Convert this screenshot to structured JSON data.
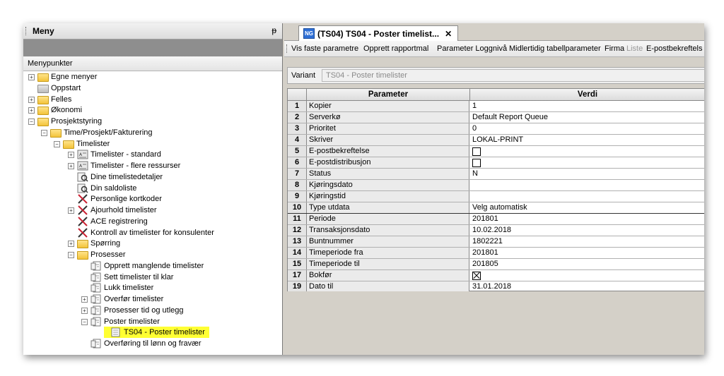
{
  "menu": {
    "title": "Meny",
    "pin": "ᵽ",
    "section_label": "Menypunkter",
    "tree": [
      {
        "label": "Egne menyer",
        "level": 0,
        "expander": "+",
        "icon": "folder-icon"
      },
      {
        "label": "Oppstart",
        "level": 0,
        "expander": "",
        "icon": "folder-gray-icon"
      },
      {
        "label": "Felles",
        "level": 0,
        "expander": "+",
        "icon": "folder-icon"
      },
      {
        "label": "Økonomi",
        "level": 0,
        "expander": "+",
        "icon": "folder-icon"
      },
      {
        "label": "Prosjektstyring",
        "level": 0,
        "expander": "−",
        "icon": "folder-open-icon"
      },
      {
        "label": "Time/Prosjekt/Fakturering",
        "level": 1,
        "expander": "−",
        "icon": "folder-open-icon"
      },
      {
        "label": "Timelister",
        "level": 2,
        "expander": "−",
        "icon": "folder-open-icon"
      },
      {
        "label": "Timelister - standard",
        "level": 3,
        "expander": "+",
        "icon": "report-icon"
      },
      {
        "label": "Timelister - flere ressurser",
        "level": 3,
        "expander": "+",
        "icon": "report-icon"
      },
      {
        "label": "Dine timelistedetaljer",
        "level": 3,
        "expander": "",
        "icon": "search-doc-icon"
      },
      {
        "label": "Din saldoliste",
        "level": 3,
        "expander": "",
        "icon": "search-doc-icon"
      },
      {
        "label": "Personlige kortkoder",
        "level": 3,
        "expander": "",
        "icon": "tools-icon"
      },
      {
        "label": "Ajourhold timelister",
        "level": 3,
        "expander": "+",
        "icon": "tools-icon"
      },
      {
        "label": "ACE registrering",
        "level": 3,
        "expander": "",
        "icon": "tools-icon"
      },
      {
        "label": "Kontroll av timelister for konsulenter",
        "level": 3,
        "expander": "",
        "icon": "tools-icon"
      },
      {
        "label": "Spørring",
        "level": 3,
        "expander": "+",
        "icon": "folder-icon"
      },
      {
        "label": "Prosesser",
        "level": 3,
        "expander": "−",
        "icon": "folder-open-icon"
      },
      {
        "label": "Opprett manglende timelister",
        "level": 4,
        "expander": "",
        "icon": "process-icon"
      },
      {
        "label": "Sett timelister til klar",
        "level": 4,
        "expander": "",
        "icon": "process-icon"
      },
      {
        "label": "Lukk timelister",
        "level": 4,
        "expander": "",
        "icon": "process-icon"
      },
      {
        "label": "Overfør timelister",
        "level": 4,
        "expander": "+",
        "icon": "process-icon"
      },
      {
        "label": "Prosesser tid og utlegg",
        "level": 4,
        "expander": "+",
        "icon": "process-icon"
      },
      {
        "label": "Poster timelister",
        "level": 4,
        "expander": "−",
        "icon": "process-icon"
      },
      {
        "label": "TS04 - Poster timelister",
        "level": 5,
        "expander": "",
        "icon": "variant-doc-icon",
        "highlighted": true
      },
      {
        "label": "Overføring til lønn og fravær",
        "level": 4,
        "expander": "",
        "icon": "process-icon"
      }
    ]
  },
  "tab": {
    "badge": "NG",
    "label": "(TS04) TS04 - Poster timelist...",
    "close": "✕"
  },
  "toolbar": [
    {
      "label": "Vis faste parametre",
      "enabled": true
    },
    {
      "label": "Opprett rapportmal",
      "enabled": true
    },
    {
      "label": "Parameter Loggnivå",
      "enabled": true
    },
    {
      "label": "Midlertidig tabellparameter",
      "enabled": true
    },
    {
      "label": "Firma",
      "enabled": true
    },
    {
      "label": "Liste",
      "enabled": false
    },
    {
      "label": "E-postbekreftels",
      "enabled": true
    }
  ],
  "variant": {
    "label": "Variant",
    "value": "TS04 - Poster timelister"
  },
  "grid": {
    "headers": [
      "",
      "Parameter",
      "Verdi"
    ],
    "rows": [
      {
        "n": "1",
        "param": "Kopier",
        "value": "1"
      },
      {
        "n": "2",
        "param": "Serverkø",
        "value": "Default Report Queue"
      },
      {
        "n": "3",
        "param": "Prioritet",
        "value": "0"
      },
      {
        "n": "4",
        "param": "Skriver",
        "value": "LOKAL-PRINT"
      },
      {
        "n": "5",
        "param": "E-postbekreftelse",
        "value": "",
        "checkbox": false
      },
      {
        "n": "6",
        "param": "E-postdistribusjon",
        "value": "",
        "checkbox": false
      },
      {
        "n": "7",
        "param": "Status",
        "value": "N"
      },
      {
        "n": "8",
        "param": "Kjøringsdato",
        "value": ""
      },
      {
        "n": "9",
        "param": "Kjøringstid",
        "value": ""
      },
      {
        "n": "10",
        "param": "Type utdata",
        "value": "Velg automatisk",
        "separator": true
      },
      {
        "n": "11",
        "param": "Periode",
        "value": "201801"
      },
      {
        "n": "12",
        "param": "Transaksjonsdato",
        "value": "10.02.2018"
      },
      {
        "n": "13",
        "param": "Buntnummer",
        "value": "1802221"
      },
      {
        "n": "14",
        "param": "Timeperiode fra",
        "value": "201801"
      },
      {
        "n": "15",
        "param": "Timeperiode til",
        "value": "201805"
      },
      {
        "n": "17",
        "param": "Bokfør",
        "value": "",
        "checkbox": true
      },
      {
        "n": "19",
        "param": "Dato til",
        "value": "31.01.2018"
      }
    ]
  }
}
